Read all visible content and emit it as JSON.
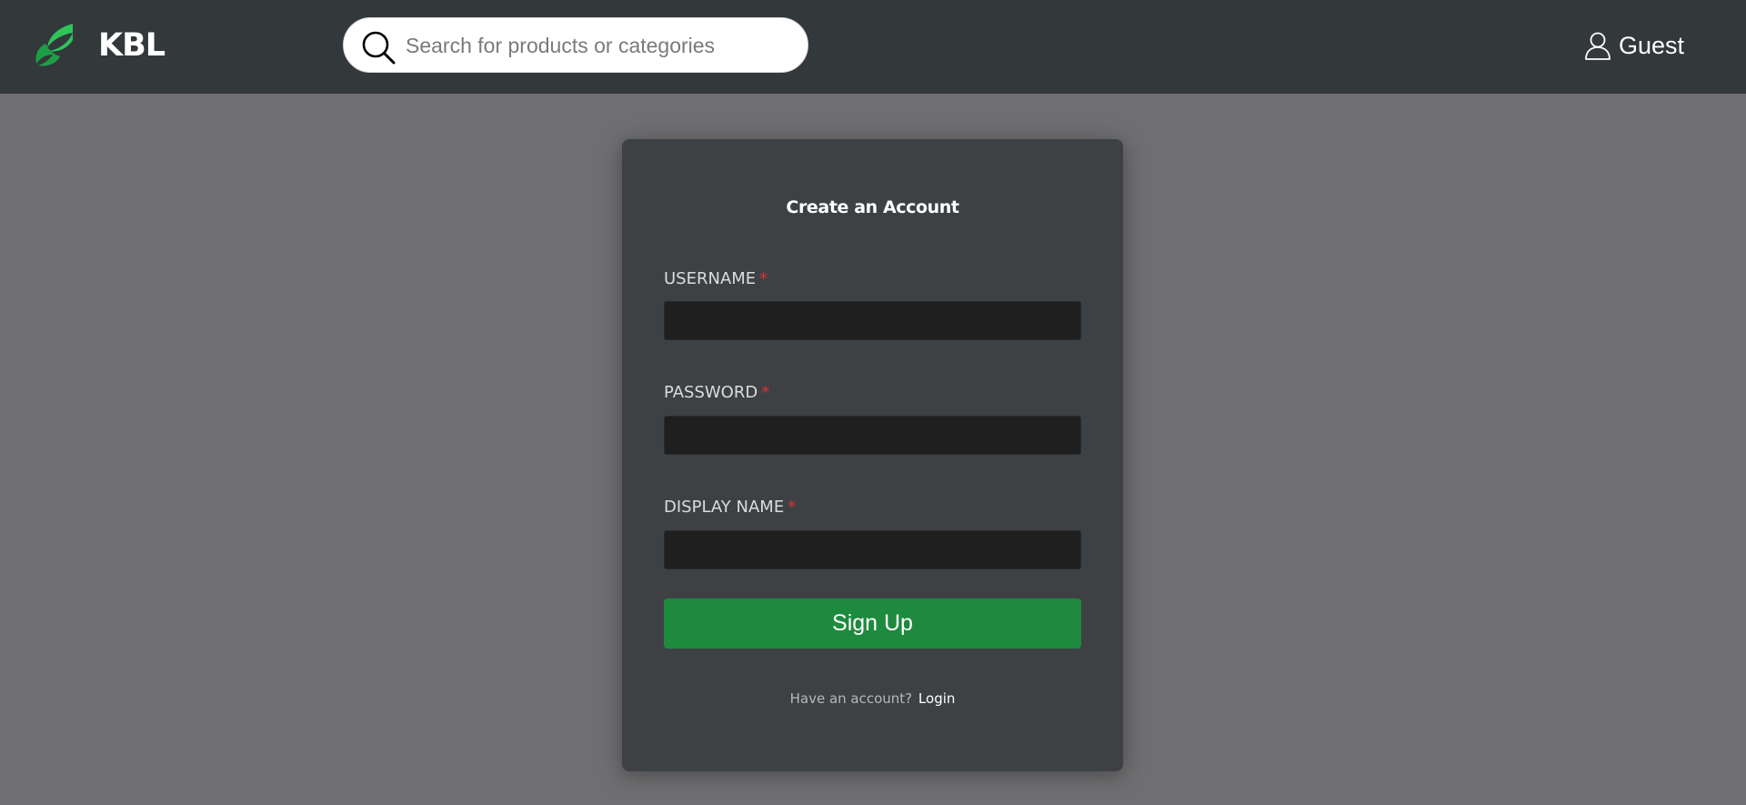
{
  "header": {
    "brand": "KBL",
    "search": {
      "placeholder": "Search for products or categories",
      "value": ""
    },
    "user_label": "Guest"
  },
  "form": {
    "title": "Create an Account",
    "fields": [
      {
        "label": "USERNAME",
        "required_mark": "*",
        "value": ""
      },
      {
        "label": "PASSWORD",
        "required_mark": "*",
        "value": ""
      },
      {
        "label": "DISPLAY NAME",
        "required_mark": "*",
        "value": ""
      }
    ],
    "submit_label": "Sign Up",
    "footer_text": "Have an account?",
    "login_link": "Login"
  },
  "colors": {
    "navbar": "#33383b",
    "page_background": "#6f6f71",
    "card": "#3e4144",
    "input": "#1f1f1f",
    "accent": "#1e8a3e",
    "required": "#e03232"
  },
  "icons": {
    "logo": "leaf-logo-icon",
    "search": "search-icon",
    "user": "user-icon"
  }
}
